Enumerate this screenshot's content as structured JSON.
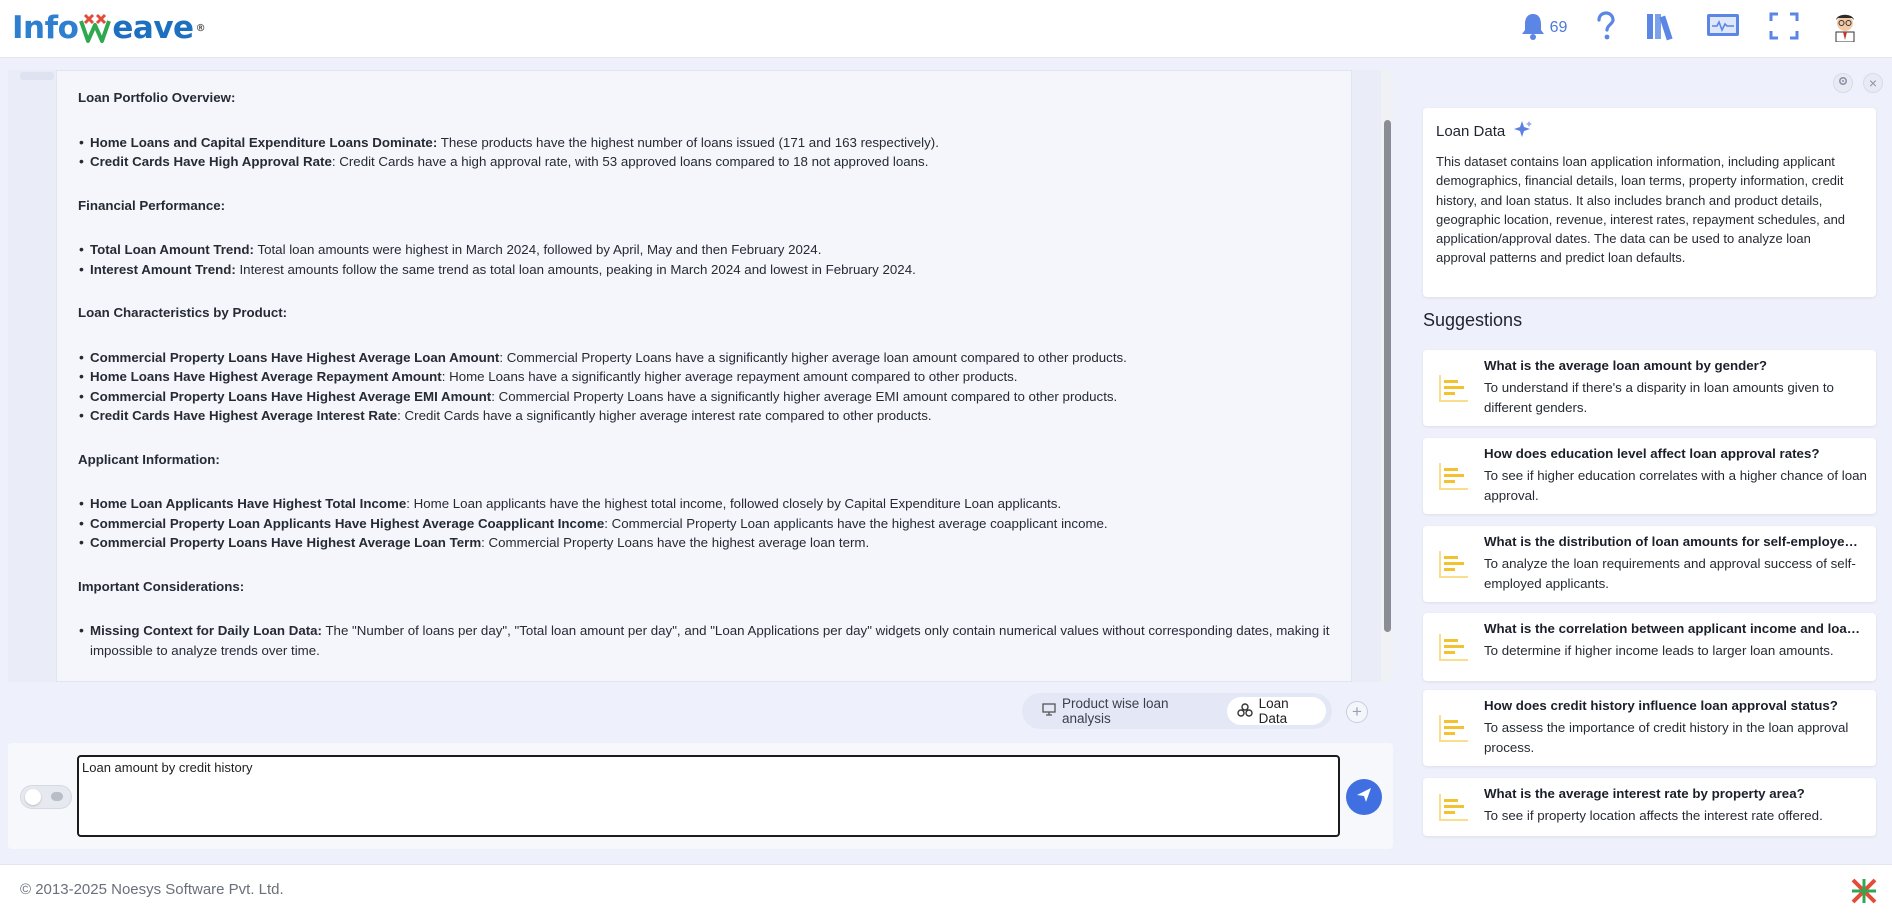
{
  "header": {
    "logo": {
      "part1": "Info",
      "part2": "eave",
      "trademark": "®"
    },
    "notification_count": "69",
    "icons": [
      "bell-icon",
      "help-icon",
      "library-icon",
      "monitor-icon",
      "fullscreen-icon",
      "avatar"
    ]
  },
  "answer": {
    "sections": [
      {
        "heading": "Loan Portfolio Overview:",
        "items": [
          {
            "bold": "Home Loans and Capital Expenditure Loans Dominate:",
            "text": " These products have the highest number of loans issued (171 and 163 respectively)."
          },
          {
            "bold": "Credit Cards Have High Approval Rate",
            "text": ": Credit Cards have a high approval rate, with 53 approved loans compared to 18 not approved loans."
          }
        ]
      },
      {
        "heading": "Financial Performance:",
        "items": [
          {
            "bold": "Total Loan Amount Trend:",
            "text": " Total loan amounts were highest in March 2024, followed by April, May and then February 2024."
          },
          {
            "bold": "Interest Amount Trend:",
            "text": " Interest amounts follow the same trend as total loan amounts, peaking in March 2024 and lowest in February 2024."
          }
        ]
      },
      {
        "heading": "Loan Characteristics by Product:",
        "items": [
          {
            "bold": "Commercial Property Loans Have Highest Average Loan Amount",
            "text": ": Commercial Property Loans have a significantly higher average loan amount compared to other products."
          },
          {
            "bold": "Home Loans Have Highest Average Repayment Amount",
            "text": ": Home Loans have a significantly higher average repayment amount compared to other products."
          },
          {
            "bold": "Commercial Property Loans Have Highest Average EMI Amount",
            "text": ": Commercial Property Loans have a significantly higher average EMI amount compared to other products."
          },
          {
            "bold": "Credit Cards Have Highest Average Interest Rate",
            "text": ": Credit Cards have a significantly higher average interest rate compared to other products."
          }
        ]
      },
      {
        "heading": "Applicant Information:",
        "items": [
          {
            "bold": "Home Loan Applicants Have Highest Total Income",
            "text": ": Home Loan applicants have the highest total income, followed closely by Capital Expenditure Loan applicants."
          },
          {
            "bold": "Commercial Property Loan Applicants Have Highest Average Coapplicant Income",
            "text": ": Commercial Property Loan applicants have the highest average coapplicant income."
          },
          {
            "bold": "Commercial Property Loans Have Highest Average Loan Term",
            "text": ": Commercial Property Loans have the highest average loan term."
          }
        ]
      },
      {
        "heading": "Important Considerations:",
        "items": [
          {
            "bold": "Missing Context for Daily Loan Data:",
            "text": " The \"Number of loans per day\", \"Total loan amount per day\", and \"Loan Applications per day\" widgets only contain numerical values without corresponding dates, making it impossible to analyze trends over time."
          }
        ]
      }
    ]
  },
  "chips": {
    "analysis_label": "Product wise loan analysis",
    "dataset_label": "Loan Data",
    "add_label": "+"
  },
  "input": {
    "value": "Loan amount by credit history"
  },
  "side": {
    "dataset_title": "Loan Data",
    "dataset_desc": "This dataset contains loan application information, including applicant demographics, financial details, loan terms, property information, credit history, and loan status. It also includes branch and product details, geographic location, revenue, interest rates, repayment schedules, and application/approval dates. The data can be used to analyze loan approval patterns and predict loan defaults.",
    "suggestions_heading": "Suggestions",
    "close_label": "×",
    "suggestions": [
      {
        "q": "What is the average loan amount by gender?",
        "d": "To understand if there's a disparity in loan amounts given to different genders."
      },
      {
        "q": "How does education level affect loan approval rates?",
        "d": "To see if higher education correlates with a higher chance of loan approval."
      },
      {
        "q": "What is the distribution of loan amounts for self-employed…",
        "d": "To analyze the loan requirements and approval success of self-employed applicants."
      },
      {
        "q": "What is the correlation between applicant income and loa…",
        "d": "To determine if higher income leads to larger loan amounts."
      },
      {
        "q": "How does credit history influence loan approval status?",
        "d": "To assess the importance of credit history in the loan approval process."
      },
      {
        "q": "What is the average interest rate by property area?",
        "d": "To see if property location affects the interest rate offered."
      }
    ]
  },
  "footer": {
    "copyright": "© 2013-2025 Noesys Software Pvt. Ltd."
  },
  "colors": {
    "accent": "#3f6fe0",
    "logo_blue": "#2f7fd1",
    "suggestion_icon": "#f2c230"
  }
}
